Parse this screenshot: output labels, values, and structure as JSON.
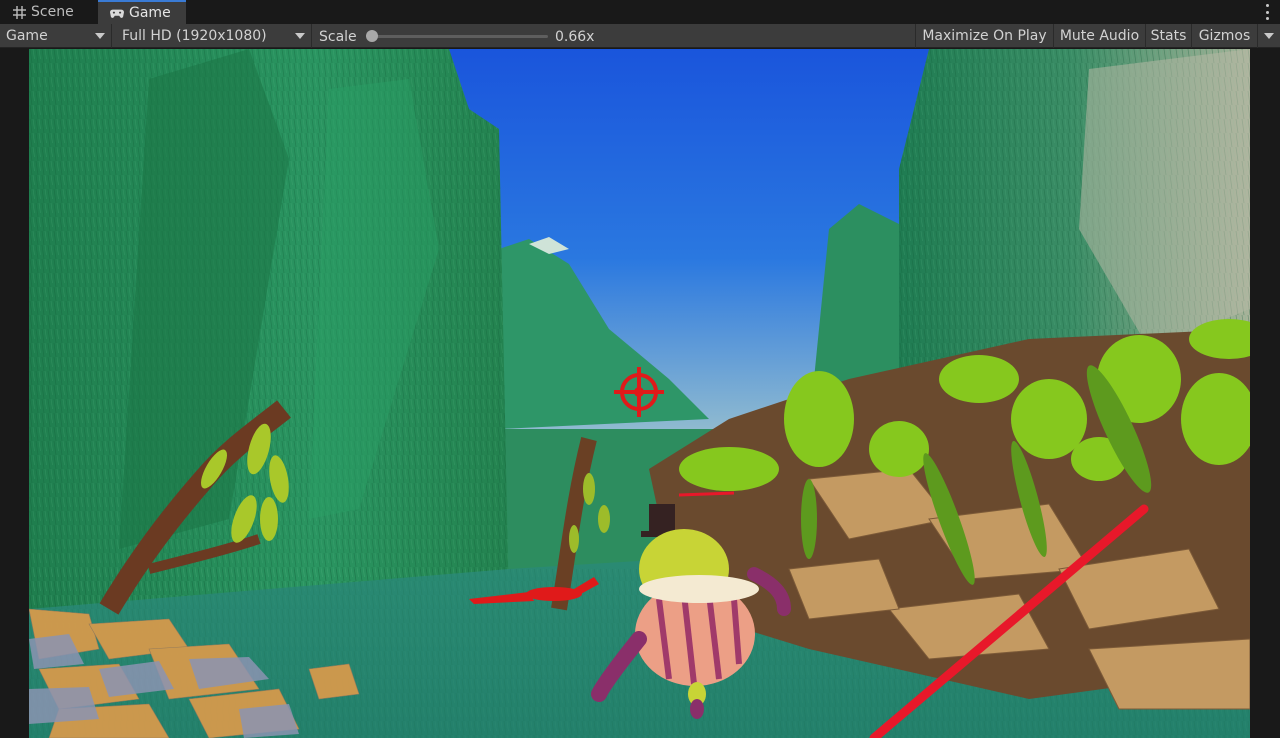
{
  "tabs": [
    {
      "label": "Scene",
      "icon": "grid-icon",
      "active": false
    },
    {
      "label": "Game",
      "icon": "gamepad-icon",
      "active": true
    }
  ],
  "toolbar": {
    "display_dropdown": "Game",
    "resolution_dropdown": "Full HD (1920x1080)",
    "scale_label": "Scale",
    "scale_value": "0.66x",
    "scale_fraction": 0.0,
    "maximize_on_play": "Maximize On Play",
    "mute_audio": "Mute Audio",
    "stats": "Stats",
    "gizmos": "Gizmos"
  },
  "viewport": {
    "sky_color": "#1e5fe0",
    "cliff_color": "#2d8d5f",
    "crosshair_color": "#e01a1a",
    "icons": [
      "crosshair-icon"
    ]
  },
  "colors": {
    "editor_bg": "#191919",
    "toolbar_bg": "#3c3c3c",
    "active_tab_accent": "#3a7bd5"
  }
}
